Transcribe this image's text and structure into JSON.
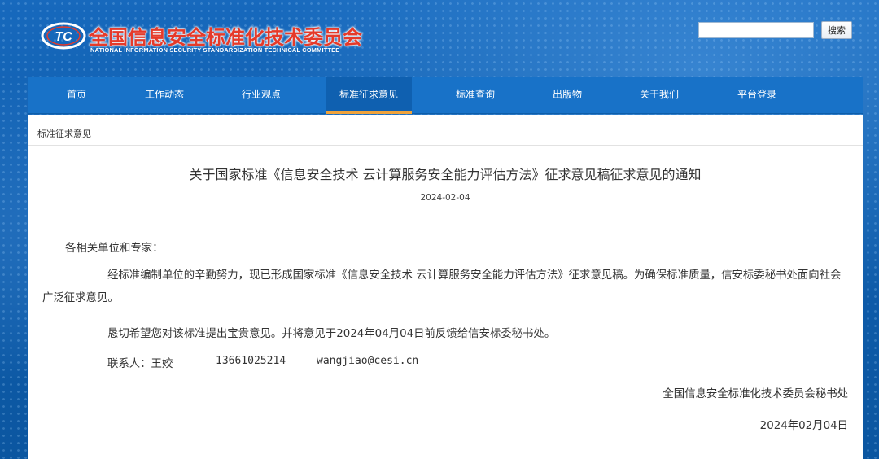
{
  "header": {
    "logo_text": "TC",
    "title_cn": "全国信息安全标准化技术委员会",
    "title_en": "NATIONAL INFORMATION SECURITY STANDARDIZATION TECHNICAL COMMITTEE",
    "search": {
      "value": "",
      "placeholder": "",
      "button_label": "搜索"
    }
  },
  "nav": {
    "items": [
      {
        "label": "首页"
      },
      {
        "label": "工作动态"
      },
      {
        "label": "行业观点"
      },
      {
        "label": "标准征求意见",
        "active": true
      },
      {
        "label": "标准查询"
      },
      {
        "label": "出版物"
      },
      {
        "label": "关于我们"
      },
      {
        "label": "平台登录"
      }
    ]
  },
  "breadcrumb": "标准征求意见",
  "article": {
    "title": "关于国家标准《信息安全技术 云计算服务安全能力评估方法》征求意见稿征求意见的通知",
    "date": "2024-02-04",
    "salutation": "各相关单位和专家：",
    "paragraph1": "经标准编制单位的辛勤努力，现已形成国家标准《信息安全技术 云计算服务安全能力评估方法》征求意见稿。为确保标准质量，信安标委秘书处面向社会广泛征求意见。",
    "paragraph2": "恳切希望您对该标准提出宝贵意见。并将意见于2024年04月04日前反馈给信安标委秘书处。",
    "contact": {
      "label": "联系人：王姣",
      "phone": "13661025214",
      "email": "wangjiao@cesi.cn"
    },
    "signature": "全国信息安全标准化技术委员会秘书处",
    "signature_date": "2024年02月04日"
  },
  "colors": {
    "nav_bg": "#1872c8",
    "nav_active_underline": "#f0a33b",
    "title_red": "#e53a2a",
    "page_bg": "#0d5ca8"
  }
}
